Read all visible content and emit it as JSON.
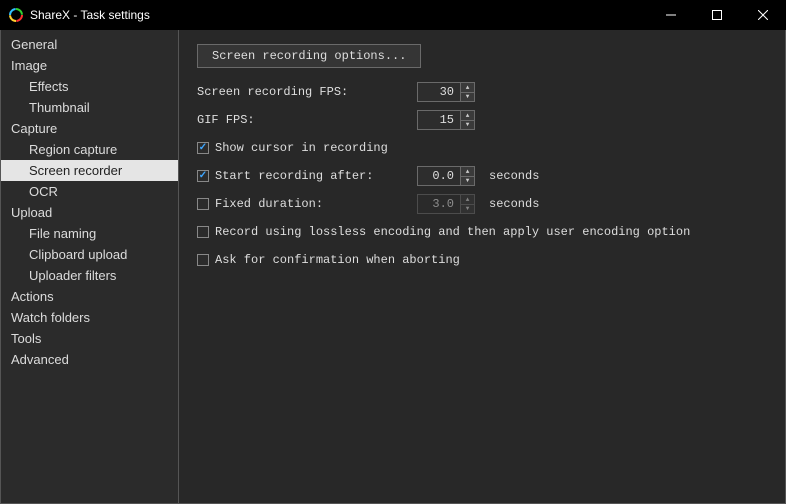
{
  "window": {
    "title": "ShareX - Task settings"
  },
  "sidebar": {
    "items": [
      {
        "label": "General",
        "level": 0,
        "selected": false
      },
      {
        "label": "Image",
        "level": 0,
        "selected": false
      },
      {
        "label": "Effects",
        "level": 1,
        "selected": false
      },
      {
        "label": "Thumbnail",
        "level": 1,
        "selected": false
      },
      {
        "label": "Capture",
        "level": 0,
        "selected": false
      },
      {
        "label": "Region capture",
        "level": 1,
        "selected": false
      },
      {
        "label": "Screen recorder",
        "level": 1,
        "selected": true
      },
      {
        "label": "OCR",
        "level": 1,
        "selected": false
      },
      {
        "label": "Upload",
        "level": 0,
        "selected": false
      },
      {
        "label": "File naming",
        "level": 1,
        "selected": false
      },
      {
        "label": "Clipboard upload",
        "level": 1,
        "selected": false
      },
      {
        "label": "Uploader filters",
        "level": 1,
        "selected": false
      },
      {
        "label": "Actions",
        "level": 0,
        "selected": false
      },
      {
        "label": "Watch folders",
        "level": 0,
        "selected": false
      },
      {
        "label": "Tools",
        "level": 0,
        "selected": false
      },
      {
        "label": "Advanced",
        "level": 0,
        "selected": false
      }
    ]
  },
  "content": {
    "options_button": "Screen recording options...",
    "fps_label": "Screen recording FPS:",
    "fps_value": "30",
    "gif_fps_label": "GIF FPS:",
    "gif_fps_value": "15",
    "show_cursor": {
      "label": "Show cursor in recording",
      "checked": true
    },
    "start_after": {
      "label": "Start recording after:",
      "checked": true,
      "value": "0.0",
      "unit": "seconds"
    },
    "fixed_duration": {
      "label": "Fixed duration:",
      "checked": false,
      "value": "3.0",
      "unit": "seconds"
    },
    "lossless": {
      "label": "Record using lossless encoding and then apply user encoding option",
      "checked": false
    },
    "confirm_abort": {
      "label": "Ask for confirmation when aborting",
      "checked": false
    }
  }
}
